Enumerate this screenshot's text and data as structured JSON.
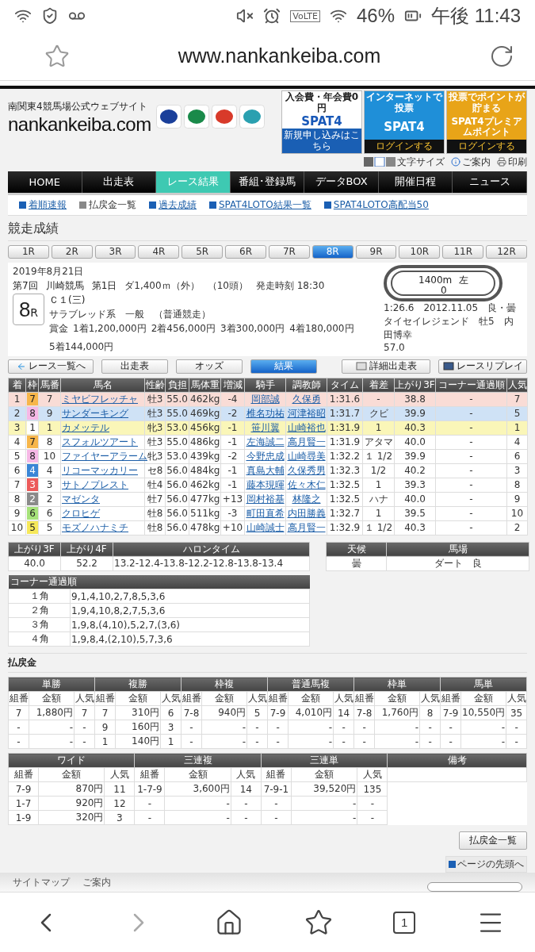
{
  "status_bar": {
    "network": "VoLTE",
    "battery": "46%",
    "time": "午後 11:43"
  },
  "browser": {
    "url": "www.nankankeiba.com"
  },
  "header": {
    "tagline": "南関東4競馬場公式ウェブサイト",
    "logo": "nankankeiba.com",
    "banners": [
      {
        "kind": "join",
        "top": "入会費・年会費0円",
        "main": "SPAT4",
        "bottom": "新規申し込みはこちら"
      },
      {
        "kind": "login",
        "top": "インターネットで投票",
        "main": "SPAT4",
        "bottom": "ログインする"
      },
      {
        "kind": "points",
        "top": "投票でポイントが貯まる",
        "main": "SPAT4プレミアムポイント",
        "bottom": "ログインする"
      }
    ],
    "tools": [
      {
        "kind": "font",
        "label": "文字サイズ"
      },
      {
        "kind": "info",
        "label": "ご案内"
      },
      {
        "kind": "print",
        "label": "印刷"
      }
    ]
  },
  "nav": [
    {
      "label": "HOME",
      "selected": false
    },
    {
      "label": "出走表",
      "selected": false
    },
    {
      "label": "レース結果",
      "selected": true
    },
    {
      "label": "番組･登録馬",
      "selected": false
    },
    {
      "label": "データBOX",
      "selected": false
    },
    {
      "label": "開催日程",
      "selected": false
    },
    {
      "label": "ニュース",
      "selected": false
    }
  ],
  "subnav": [
    {
      "label": "着順速報",
      "disabled": false
    },
    {
      "label": "払戻金一覧",
      "disabled": true
    },
    {
      "label": "過去成績",
      "disabled": false
    },
    {
      "label": "SPAT4LOTO結果一覧",
      "disabled": false
    },
    {
      "label": "SPAT4LOTO高配当50",
      "disabled": false
    }
  ],
  "page_title": "競走成績",
  "race_tabs": [
    {
      "label": "1R",
      "selected": false
    },
    {
      "label": "2R",
      "selected": false
    },
    {
      "label": "3R",
      "selected": false
    },
    {
      "label": "4R",
      "selected": false
    },
    {
      "label": "5R",
      "selected": false
    },
    {
      "label": "6R",
      "selected": false
    },
    {
      "label": "7R",
      "selected": false
    },
    {
      "label": "8R",
      "selected": true
    },
    {
      "label": "9R",
      "selected": false
    },
    {
      "label": "10R",
      "selected": false
    },
    {
      "label": "11R",
      "selected": false
    },
    {
      "label": "12R",
      "selected": false
    }
  ],
  "race": {
    "date": "2019年8月21日",
    "meeting": "第7回",
    "track": "川崎競馬",
    "day": "第1日",
    "course": "ダ1,400ｍ（外）",
    "runners": "（10頭）",
    "start": "発走時刻 18:30",
    "number": "8",
    "number_suffix": "R",
    "class": "Ｃ１(三)",
    "condition": "サラブレッド系　一般　（普通競走）",
    "prizes": [
      "賞金",
      "1着1,200,000円",
      "2着456,000円",
      "3着300,000円",
      "4着180,000円",
      "5着144,000円"
    ],
    "course_map": {
      "distance": "1400m",
      "direction": "左",
      "marker": "0"
    },
    "record": [
      "1:26.6　2012.11.05　良・曇",
      "タイセイレジェンド　牡5　内田博幸",
      "57.0"
    ]
  },
  "actions": [
    {
      "kind": "back",
      "label": "レース一覧へ",
      "selected": false
    },
    {
      "kind": "plain",
      "label": "出走表",
      "selected": false
    },
    {
      "kind": "plain",
      "label": "オッズ",
      "selected": false
    },
    {
      "kind": "plain",
      "label": "結果",
      "selected": true
    },
    {
      "kind": "detail",
      "label": "詳細出走表",
      "selected": false
    },
    {
      "kind": "replay",
      "label": "レースリプレイ",
      "selected": false
    }
  ],
  "results": {
    "columns": [
      {
        "label": "着",
        "kind": "text"
      },
      {
        "label": "枠",
        "kind": "frame"
      },
      {
        "label": "馬番",
        "kind": "text"
      },
      {
        "label": "馬名",
        "kind": "name"
      },
      {
        "label": "性齢",
        "kind": "text"
      },
      {
        "label": "負担",
        "kind": "text"
      },
      {
        "label": "馬体重",
        "kind": "text"
      },
      {
        "label": "増減",
        "kind": "text"
      },
      {
        "label": "騎手",
        "kind": "link"
      },
      {
        "label": "調教師",
        "kind": "link"
      },
      {
        "label": "タイム",
        "kind": "text"
      },
      {
        "label": "着差",
        "kind": "text"
      },
      {
        "label": "上がり3F",
        "kind": "text"
      },
      {
        "label": "コーナー通過順",
        "kind": "text"
      },
      {
        "label": "人気",
        "kind": "text"
      }
    ],
    "rows": [
      {
        "color": "#f9dcd6",
        "frame": {
          "color": "#f7b64a"
        },
        "cells": [
          "1",
          "7",
          "7",
          "ミヤビフレッチャ",
          "牡3",
          "55.0",
          "462kg",
          "-4",
          "岡部誠",
          "久保勇",
          "1:31.6",
          "-",
          "38.8",
          "-",
          "7"
        ]
      },
      {
        "color": "#cfe2f6",
        "frame": {
          "color": "#f6b8e6"
        },
        "cells": [
          "2",
          "8",
          "9",
          "サンダーキング",
          "牡3",
          "55.0",
          "469kg",
          "-2",
          "椎名功祐",
          "河津裕昭",
          "1:31.7",
          "クビ",
          "39.9",
          "-",
          "5"
        ]
      },
      {
        "color": "#faf6b8",
        "frame": {
          "color": "#ffffff"
        },
        "cells": [
          "3",
          "1",
          "1",
          "カメッテル",
          "牝3",
          "53.0",
          "456kg",
          "-1",
          "笹川翼",
          "山崎裕也",
          "1:31.9",
          "1",
          "40.3",
          "-",
          "1"
        ]
      },
      {
        "frame": {
          "color": "#f7b64a"
        },
        "cells": [
          "4",
          "7",
          "8",
          "スフォルツアート",
          "牡3",
          "55.0",
          "486kg",
          "-1",
          "左海誠二",
          "高月賢一",
          "1:31.9",
          "アタマ",
          "40.0",
          "-",
          "4"
        ]
      },
      {
        "frame": {
          "color": "#f6b8e6"
        },
        "cells": [
          "5",
          "8",
          "10",
          "ファイヤーアラーム",
          "牝3",
          "53.0",
          "439kg",
          "-2",
          "今野忠成",
          "山崎尋美",
          "1:32.2",
          "１ 1/2",
          "39.9",
          "-",
          "6"
        ]
      },
      {
        "frame": {
          "color": "#3a86d6"
        },
        "cells": [
          "6",
          "4",
          "4",
          "リコーマッカリー",
          "セ8",
          "56.0",
          "484kg",
          "-1",
          "真島大輔",
          "久保秀男",
          "1:32.3",
          "1/2",
          "40.2",
          "-",
          "3"
        ]
      },
      {
        "frame": {
          "color": "#ec5a5a"
        },
        "cells": [
          "7",
          "3",
          "3",
          "サトノプレスト",
          "牡4",
          "56.0",
          "462kg",
          "-1",
          "藤本現暉",
          "佐々木仁",
          "1:32.5",
          "1",
          "39.3",
          "-",
          "8"
        ]
      },
      {
        "frame": {
          "color": "#8a8a8a"
        },
        "cells": [
          "8",
          "2",
          "2",
          "マゼンタ",
          "牡7",
          "56.0",
          "477kg",
          "+13",
          "岡村裕基",
          "林隆之",
          "1:32.5",
          "ハナ",
          "40.0",
          "-",
          "9"
        ]
      },
      {
        "frame": {
          "color": "#a6e27a"
        },
        "cells": [
          "9",
          "6",
          "6",
          "クロヒゲ",
          "牡8",
          "56.0",
          "511kg",
          "-3",
          "町田直希",
          "内田勝義",
          "1:32.7",
          "1",
          "39.5",
          "-",
          "10"
        ]
      },
      {
        "frame": {
          "color": "#f6e85a"
        },
        "cells": [
          "10",
          "5",
          "5",
          "モズノハナミチ",
          "牡8",
          "56.0",
          "478kg",
          "+10",
          "山崎誠士",
          "高月賢一",
          "1:32.9",
          "１ 1/2",
          "40.3",
          "-",
          "2"
        ]
      }
    ]
  },
  "times": {
    "columns": [
      "上がり3F",
      "上がり4F",
      "ハロンタイム"
    ],
    "values": [
      "40.0",
      "52.2",
      "13.2-12.4-13.8-12.2-12.8-13.8-13.4"
    ]
  },
  "conditions": {
    "columns": [
      "天候",
      "馬場"
    ],
    "values": [
      "曇",
      "ダート　良"
    ]
  },
  "corners": {
    "title": "コーナー通過順",
    "rows": [
      {
        "corner": "１角",
        "order": "9,1,4,10,2,7,8,5,3,6"
      },
      {
        "corner": "２角",
        "order": "1,9,4,10,8,2,7,5,3,6"
      },
      {
        "corner": "３角",
        "order": "1,9,8,(4,10),5,2,7,(3,6)"
      },
      {
        "corner": "４角",
        "order": "1,9,8,4,(2,10),5,7,3,6"
      }
    ]
  },
  "payouts": {
    "title": "払戻金",
    "table_1": [
      {
        "name": "単勝",
        "columns": [
          "組番",
          "金額",
          "人気"
        ],
        "rows": [
          [
            "7",
            "1,880円",
            "7"
          ],
          [
            "-",
            "-",
            "-"
          ],
          [
            "-",
            "-",
            "-"
          ]
        ]
      },
      {
        "name": "複勝",
        "columns": [
          "組番",
          "金額",
          "人気"
        ],
        "rows": [
          [
            "7",
            "310円",
            "6"
          ],
          [
            "9",
            "160円",
            "3"
          ],
          [
            "1",
            "140円",
            "1"
          ]
        ]
      },
      {
        "name": "枠複",
        "columns": [
          "組番",
          "金額",
          "人気"
        ],
        "rows": [
          [
            "7-8",
            "940円",
            "5"
          ],
          [
            "-",
            "-",
            "-"
          ],
          [
            "-",
            "-",
            "-"
          ]
        ]
      },
      {
        "name": "普通馬複",
        "columns": [
          "組番",
          "金額",
          "人気"
        ],
        "rows": [
          [
            "7-9",
            "4,010円",
            "14"
          ],
          [
            "-",
            "-",
            "-"
          ],
          [
            "-",
            "-",
            "-"
          ]
        ]
      },
      {
        "name": "枠単",
        "columns": [
          "組番",
          "金額",
          "人気"
        ],
        "rows": [
          [
            "7-8",
            "1,760円",
            "8"
          ],
          [
            "-",
            "-",
            "-"
          ],
          [
            "-",
            "-",
            "-"
          ]
        ]
      },
      {
        "name": "馬単",
        "columns": [
          "組番",
          "金額",
          "人気"
        ],
        "rows": [
          [
            "7-9",
            "10,550円",
            "35"
          ],
          [
            "-",
            "-",
            "-"
          ],
          [
            "-",
            "-",
            "-"
          ]
        ]
      }
    ],
    "table_2": [
      {
        "name": "ワイド",
        "columns": [
          "組番",
          "金額",
          "人気"
        ],
        "rows": [
          [
            "7-9",
            "870円",
            "11"
          ],
          [
            "1-7",
            "920円",
            "12"
          ],
          [
            "1-9",
            "320円",
            "3"
          ]
        ]
      },
      {
        "name": "三連複",
        "columns": [
          "組番",
          "金額",
          "人気"
        ],
        "rows": [
          [
            "1-7-9",
            "3,600円",
            "14"
          ],
          [
            "-",
            "-",
            "-"
          ],
          [
            "-",
            "-",
            "-"
          ]
        ]
      },
      {
        "name": "三連単",
        "columns": [
          "組番",
          "金額",
          "人気"
        ],
        "rows": [
          [
            "7-9-1",
            "39,520円",
            "135"
          ],
          [
            "-",
            "-",
            "-"
          ],
          [
            "-",
            "-",
            "-"
          ]
        ]
      }
    ],
    "remarks_title": "備考"
  },
  "payout_list_button": "払戻金一覧",
  "page_top": "ページの先頭へ",
  "footer": {
    "links": [
      "サイトマップ",
      "ご案内"
    ]
  },
  "bottom_nav": {
    "tab_count": "1"
  }
}
